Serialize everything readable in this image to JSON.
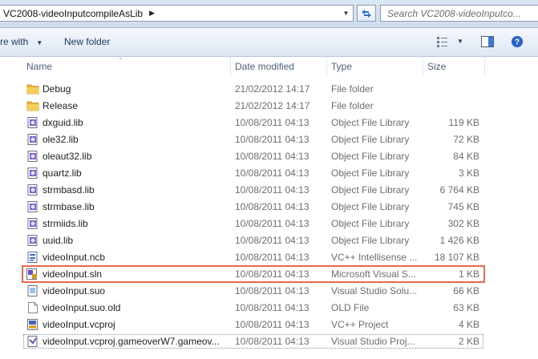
{
  "address": {
    "path": "VC2008-videoInputcompileAsLib"
  },
  "search": {
    "placeholder": "Search VC2008-videoInputco..."
  },
  "toolbar": {
    "share_label": "re with",
    "new_folder_label": "New folder"
  },
  "columns": {
    "name": "Name",
    "date": "Date modified",
    "type": "Type",
    "size": "Size"
  },
  "files": [
    {
      "name": "Debug",
      "date": "21/02/2012 14:17",
      "type": "File folder",
      "size": "",
      "icon": "folder-icon"
    },
    {
      "name": "Release",
      "date": "21/02/2012 14:17",
      "type": "File folder",
      "size": "",
      "icon": "folder-icon"
    },
    {
      "name": "dxguid.lib",
      "date": "10/08/2011 04:13",
      "type": "Object File Library",
      "size": "119 KB",
      "icon": "library-file-icon"
    },
    {
      "name": "ole32.lib",
      "date": "10/08/2011 04:13",
      "type": "Object File Library",
      "size": "72 KB",
      "icon": "library-file-icon"
    },
    {
      "name": "oleaut32.lib",
      "date": "10/08/2011 04:13",
      "type": "Object File Library",
      "size": "84 KB",
      "icon": "library-file-icon"
    },
    {
      "name": "quartz.lib",
      "date": "10/08/2011 04:13",
      "type": "Object File Library",
      "size": "3 KB",
      "icon": "library-file-icon"
    },
    {
      "name": "strmbasd.lib",
      "date": "10/08/2011 04:13",
      "type": "Object File Library",
      "size": "6 764 KB",
      "icon": "library-file-icon"
    },
    {
      "name": "strmbase.lib",
      "date": "10/08/2011 04:13",
      "type": "Object File Library",
      "size": "745 KB",
      "icon": "library-file-icon"
    },
    {
      "name": "strmiids.lib",
      "date": "10/08/2011 04:13",
      "type": "Object File Library",
      "size": "302 KB",
      "icon": "library-file-icon"
    },
    {
      "name": "uuid.lib",
      "date": "10/08/2011 04:13",
      "type": "Object File Library",
      "size": "1 426 KB",
      "icon": "library-file-icon"
    },
    {
      "name": "videoInput.ncb",
      "date": "10/08/2011 04:13",
      "type": "VC++ Intellisense ...",
      "size": "18 107 KB",
      "icon": "intellisense-file-icon"
    },
    {
      "name": "videoInput.sln",
      "date": "10/08/2011 04:13",
      "type": "Microsoft Visual S...",
      "size": "1 KB",
      "icon": "solution-file-icon"
    },
    {
      "name": "videoInput.suo",
      "date": "10/08/2011 04:13",
      "type": "Visual Studio Solu...",
      "size": "66 KB",
      "icon": "suo-file-icon"
    },
    {
      "name": "videoInput.suo.old",
      "date": "10/08/2011 04:13",
      "type": "OLD File",
      "size": "63 KB",
      "icon": "blank-file-icon"
    },
    {
      "name": "videoInput.vcproj",
      "date": "10/08/2011 04:13",
      "type": "VC++ Project",
      "size": "4 KB",
      "icon": "vcproj-file-icon"
    },
    {
      "name": "videoInput.vcproj.gameoverW7.gameov...",
      "date": "10/08/2011 04:13",
      "type": "Visual Studio Proj...",
      "size": "2 KB",
      "icon": "vs-project-file-icon"
    }
  ],
  "colors": {
    "selection_outline": "#e86a4f",
    "header_text": "#4c607a"
  }
}
